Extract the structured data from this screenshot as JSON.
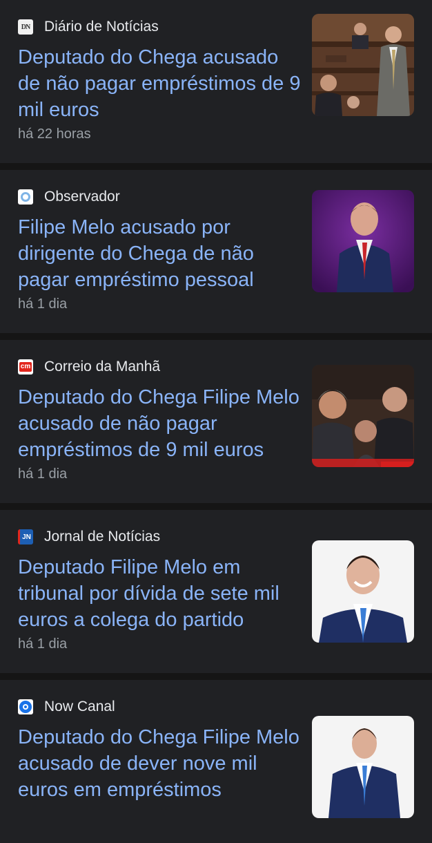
{
  "articles": [
    {
      "source": "Diário de Notícias",
      "source_icon": "diario-de-noticias-logo-icon",
      "source_logo_text": "DN",
      "headline": "Deputado do Chega acusado de não pagar empréstimos de 9 mil euros",
      "time": "há 22 horas"
    },
    {
      "source": "Observador",
      "source_icon": "observador-logo-icon",
      "headline": "Filipe Melo acusado por dirigente do Chega de não pagar empréstimo pessoal",
      "time": "há 1 dia"
    },
    {
      "source": "Correio da Manhã",
      "source_icon": "correio-da-manha-logo-icon",
      "source_logo_text": "cm",
      "headline": "Deputado do Chega Filipe Melo acusado de não pagar empréstimos de 9 mil euros",
      "time": "há 1 dia"
    },
    {
      "source": "Jornal de Notícias",
      "source_icon": "jornal-de-noticias-logo-icon",
      "source_logo_text": "JN",
      "headline": "Deputado Filipe Melo em tribunal por dívida de sete mil euros a colega do partido",
      "time": "há 1 dia"
    },
    {
      "source": "Now Canal",
      "source_icon": "now-canal-logo-icon",
      "headline": "Deputado do Chega Filipe Melo acusado de dever nove mil euros em empréstimos",
      "time": ""
    }
  ],
  "colors": {
    "background": "#1b1b1b",
    "card": "#202124",
    "headline": "#8ab4f8",
    "source_text": "#e8eaed",
    "time_text": "#9aa0a6",
    "cm_red": "#e2261d",
    "jn_blue": "#1d5fb4",
    "now_blue": "#1a73e8"
  }
}
